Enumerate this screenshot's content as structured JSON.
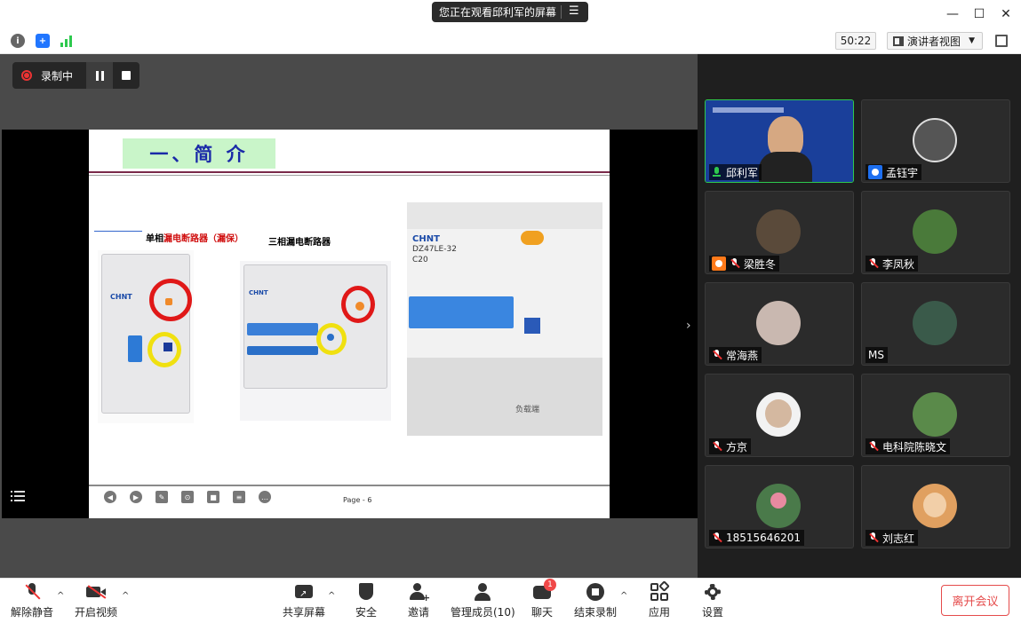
{
  "title_bar": {
    "share_banner": "您正在观看邱利军的屏幕"
  },
  "top_row": {
    "timer": "50:22",
    "view_label": "演讲者视图"
  },
  "recording": {
    "label": "录制中"
  },
  "slide": {
    "title": "一、简  介",
    "caption_left_prefix": "单相",
    "caption_left_red": "漏电断路器（漏保）",
    "caption_mid": "三相漏电断路器",
    "brand": "CHNT",
    "model": "DZ47LE-32",
    "rating": "C20",
    "bottom_label": "负载端",
    "page_label": "Page - 6"
  },
  "participants": [
    {
      "name": "邱利军",
      "mic": "on",
      "active": true,
      "avatar_color": "#1a3f9a"
    },
    {
      "name": "孟钰宇",
      "mic": "user",
      "active": false,
      "avatar_color": "#555555"
    },
    {
      "name": "梁胜冬",
      "mic": "user-orange-muted",
      "active": false,
      "avatar_color": "#5a4a3a"
    },
    {
      "name": "李凤秋",
      "mic": "muted",
      "active": false,
      "avatar_color": "#4a7a3a"
    },
    {
      "name": "常海燕",
      "mic": "muted",
      "active": false,
      "avatar_color": "#c9b8b0"
    },
    {
      "name": "MS",
      "mic": "none",
      "active": false,
      "avatar_color": "#3a5a4a"
    },
    {
      "name": "方京",
      "mic": "muted",
      "active": false,
      "avatar_color": "#e8dcd0"
    },
    {
      "name": "电科院陈晓文",
      "mic": "muted",
      "active": false,
      "avatar_color": "#5a8a4a"
    },
    {
      "name": "18515646201",
      "mic": "muted",
      "active": false,
      "avatar_color": "#4a7a4a"
    },
    {
      "name": "刘志红",
      "mic": "muted",
      "active": false,
      "avatar_color": "#e0a060"
    }
  ],
  "toolbar": {
    "unmute": "解除静音",
    "start_video": "开启视频",
    "share_screen": "共享屏幕",
    "security": "安全",
    "invite": "邀请",
    "manage_members": "管理成员(10)",
    "chat": "聊天",
    "chat_badge": "1",
    "end_recording": "结束录制",
    "apps": "应用",
    "settings": "设置",
    "leave": "离开会议"
  }
}
